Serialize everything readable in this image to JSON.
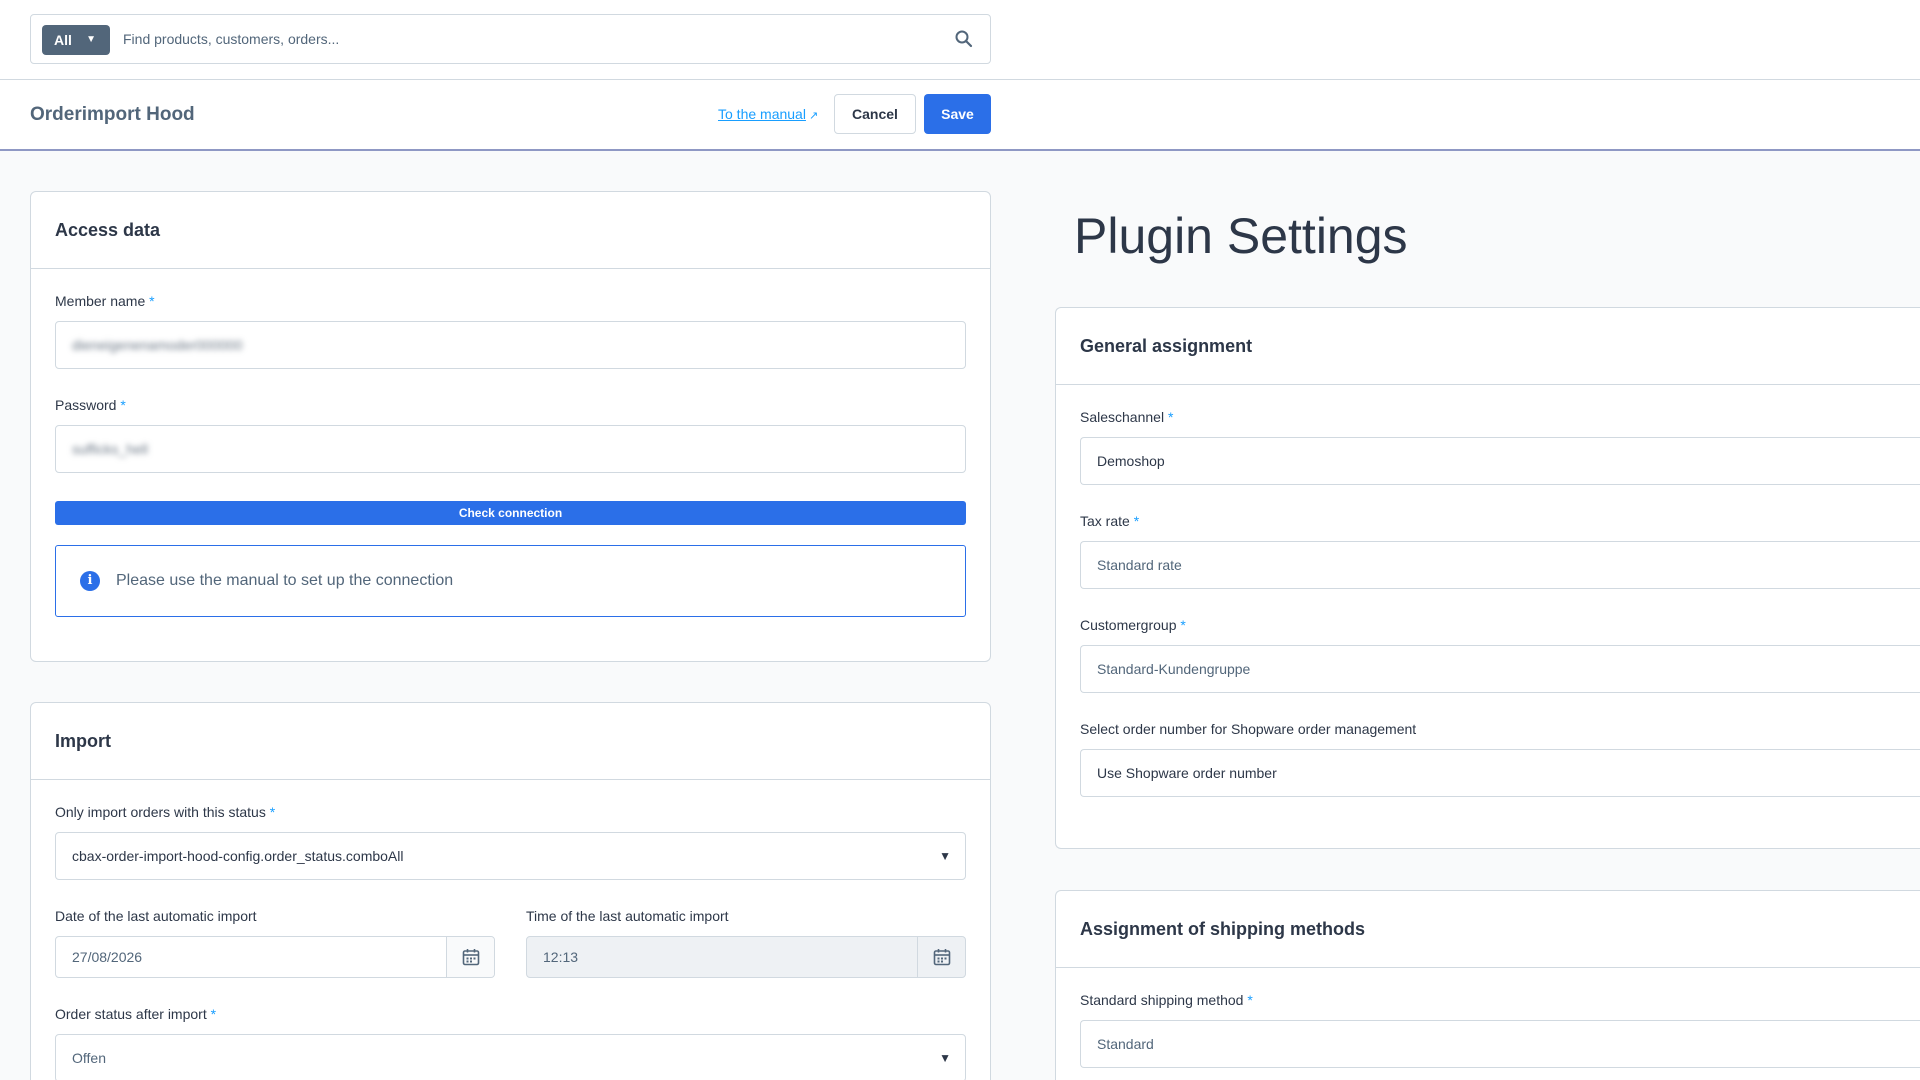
{
  "search": {
    "type_label": "All",
    "placeholder": "Find products, customers, orders..."
  },
  "smartbar": {
    "title": "Orderimport Hood",
    "manual_link": "To the manual",
    "cancel_label": "Cancel",
    "save_label": "Save"
  },
  "access_data": {
    "title": "Access data",
    "member_label": "Member name",
    "member_value": "dieneigenenamoder000000",
    "password_label": "Password",
    "password_value": "sufficks_hell",
    "check_button": "Check connection",
    "info_text": "Please use the manual to set up the connection"
  },
  "import": {
    "title": "Import",
    "status_label": "Only import orders with this status",
    "status_value": "cbax-order-import-hood-config.order_status.comboAll",
    "date_label": "Date of the last automatic import",
    "date_value": "27/08/2026",
    "time_label": "Time of the last automatic import",
    "time_value": "12:13",
    "after_label": "Order status after import",
    "after_value": "Offen"
  },
  "plugin_settings": {
    "title": "Plugin Settings"
  },
  "general": {
    "title": "General assignment",
    "saleschannel_label": "Saleschannel",
    "saleschannel_value": "Demoshop",
    "tax_label": "Tax rate",
    "tax_value": "Standard rate",
    "customergroup_label": "Customergroup",
    "customergroup_value": "Standard-Kundengruppe",
    "ordernumber_label": "Select order number for Shopware order management",
    "ordernumber_value": "Use Shopware order number"
  },
  "shipping": {
    "title": "Assignment of shipping methods",
    "standard_label": "Standard shipping method",
    "standard_value": "Standard"
  },
  "required_mark": "*",
  "colors": {
    "primary": "#2b6fe8",
    "required": "#189eff",
    "search_type_bg": "#52667a"
  }
}
